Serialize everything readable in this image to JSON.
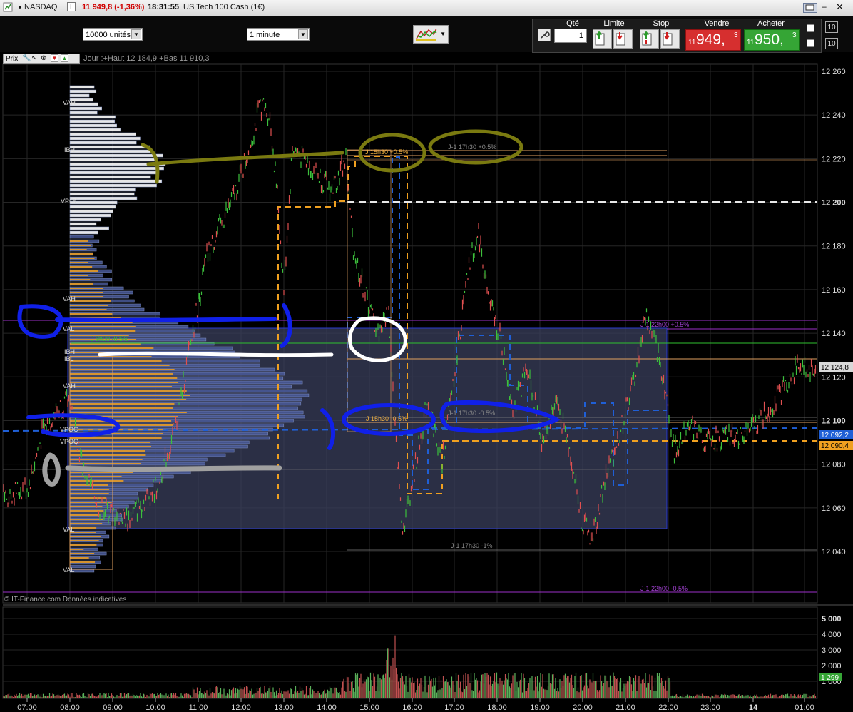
{
  "titlebar": {
    "instrument": "NASDAQ",
    "price_change": "11 949,8 (-1,36%)",
    "time": "18:31:55",
    "description": "US Tech 100 Cash (1€)"
  },
  "toolbar": {
    "units_value": "10000 unités",
    "interval_value": "1 minute"
  },
  "trade_panel": {
    "qty_label": "Qté",
    "qty_value": "1",
    "limit_label": "Limite",
    "stop_label": "Stop",
    "sell_label": "Vendre",
    "buy_label": "Acheter",
    "sell_price_small": "11",
    "sell_price_big": "949,",
    "sell_price_sup": "3",
    "buy_price_small": "11",
    "buy_price_big": "950,",
    "buy_price_sup": "3",
    "spin_top": "10",
    "spin_bottom": "10"
  },
  "chart_header": {
    "prix_label": "Prix",
    "day_info": "Jour :+Haut 12 184,9 +Bas 11 910,3"
  },
  "price_axis": {
    "labels": [
      "12 260",
      "12 240",
      "12 220",
      "12 200",
      "12 180",
      "12 160",
      "12 140",
      "12 120",
      "12 100",
      "12 080",
      "12 060",
      "12 040"
    ],
    "current_price": "12 124,8",
    "blue_level": "12 092,2",
    "orange_level": "12 090,4"
  },
  "volume_axis": {
    "labels": [
      "5 000",
      "4 000",
      "3 000",
      "2 000",
      "1 000"
    ],
    "current_volume": "1 299"
  },
  "time_axis": {
    "labels": [
      "07:00",
      "08:00",
      "09:00",
      "10:00",
      "11:00",
      "12:00",
      "13:00",
      "14:00",
      "15:00",
      "16:00",
      "17:00",
      "18:00",
      "19:00",
      "20:00",
      "21:00",
      "22:00",
      "23:00",
      "14",
      "01:00"
    ]
  },
  "profile_labels": {
    "vah_top": "VAH",
    "ib_top": "IBH",
    "vpoc_top": "VPOC",
    "vah2": "VAH",
    "val2": "VAL",
    "ib2a": "IBH",
    "ib2b": "IBL",
    "vah3": "VAH",
    "vpoc3": "VPOC",
    "vpoc4": "VPOC",
    "val3": "VAL",
    "val4": "VAL"
  },
  "annotations": {
    "j_1530_up": "J 15h30 +0.5%",
    "j1_1730_up": "J-1 17h30 +0.5%",
    "j_1530_down": "J 15h30 -0.5%",
    "j1_1730_down": "J-1 17h30 -0.5%",
    "j_9h00": "J 9h00 -0.5%",
    "j1_1730_1pct": "J-1 17h30 -1%",
    "j1_22h00_up": "J-1 22h00 +0.5%",
    "j1_22h00_down": "J-1 22h00 -0.5%"
  },
  "footer": {
    "copyright": "© IT-Finance.com  Données indicatives"
  },
  "colors": {
    "sell_red": "#d62f2f",
    "buy_green": "#35a535",
    "blue_line": "#1f5fd6",
    "orange_line": "#f0a020",
    "purple_line": "#9b30c8",
    "marker_blue": "#1020e8",
    "marker_olive": "#7a7a10"
  }
}
